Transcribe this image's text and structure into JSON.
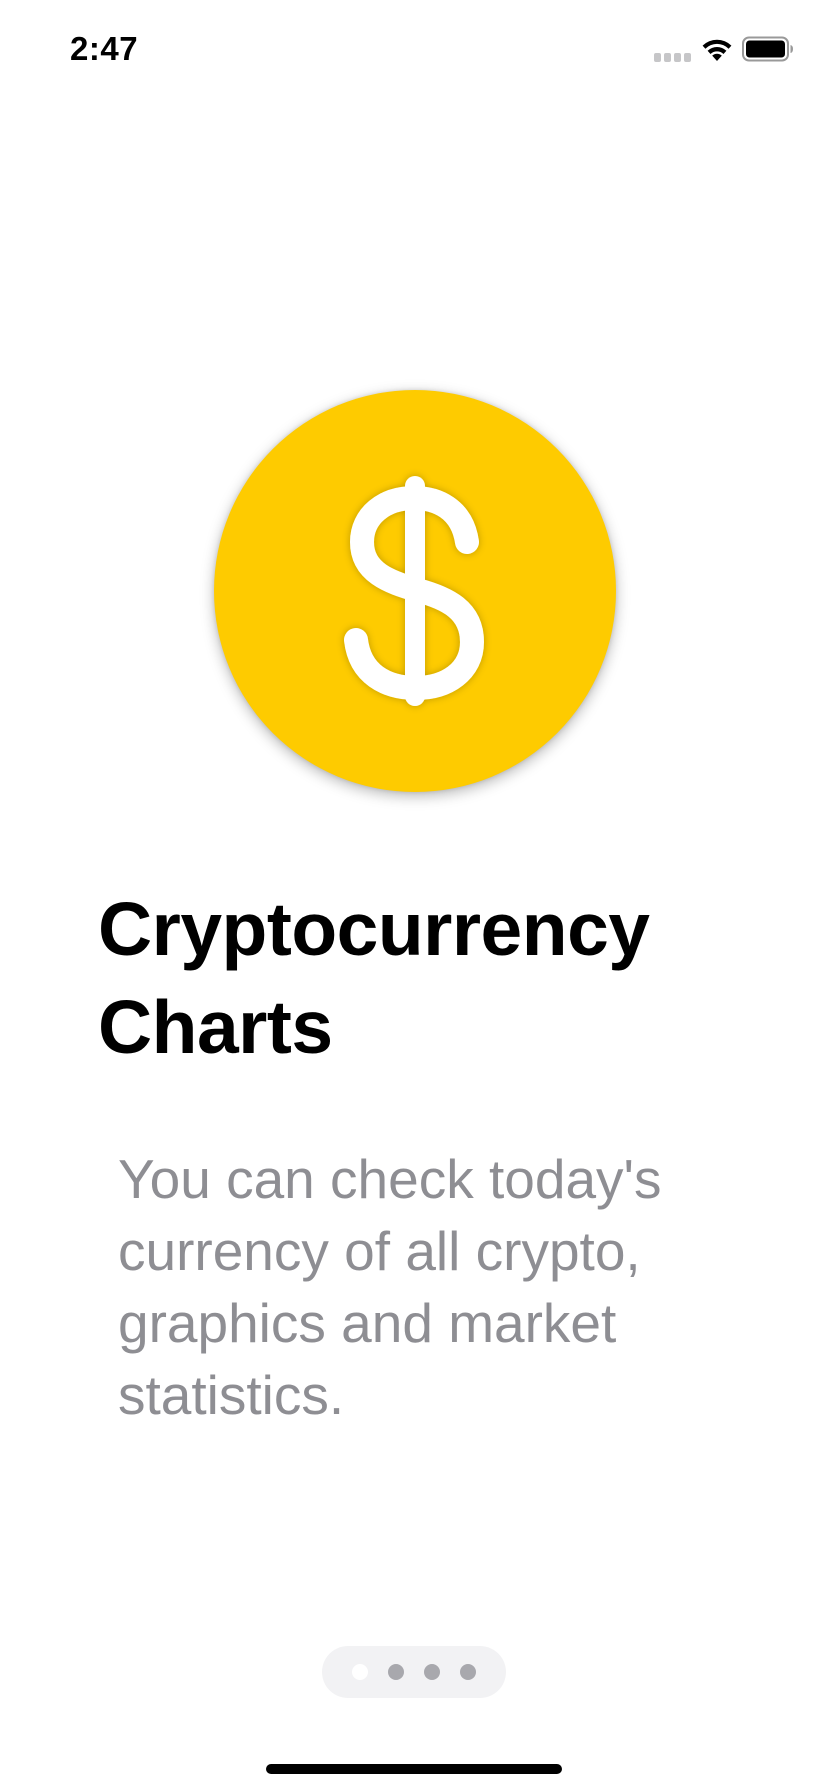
{
  "status_bar": {
    "time": "2:47",
    "icons": [
      "cellular-signal-icon",
      "wifi-icon",
      "battery-icon"
    ]
  },
  "hero": {
    "icon": "dollar-sign-icon",
    "coin_color": "#fecb00"
  },
  "title": "Cryptocurrency Charts",
  "description": "You can check today's currency of all crypto, graphics and market statistics.",
  "pagination": {
    "total_pages": 4,
    "current_page": 1
  },
  "colors": {
    "title": "#000000",
    "description": "#8e8e93",
    "dot_inactive": "#a8a8ad",
    "dot_active": "#ffffff"
  }
}
